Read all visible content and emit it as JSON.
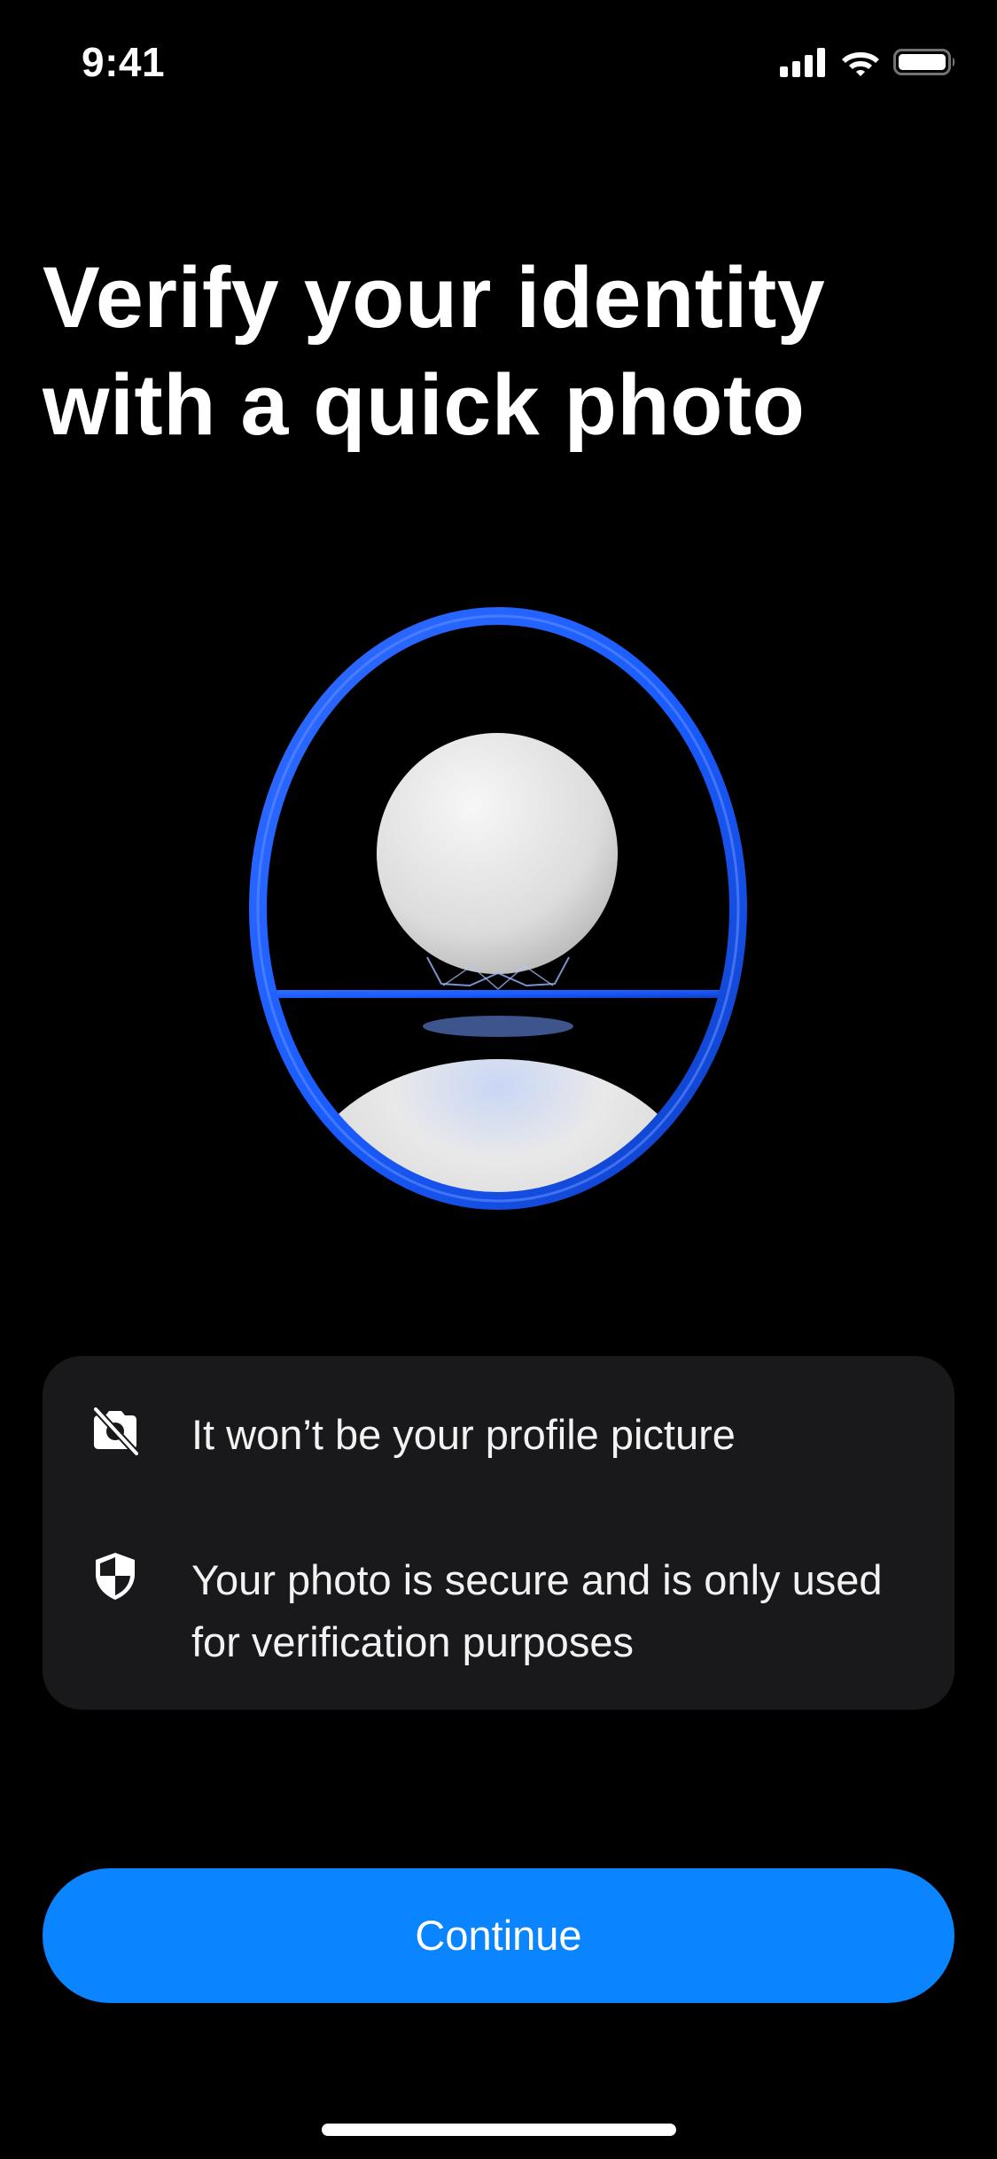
{
  "status_bar": {
    "time": "9:41",
    "icons": [
      "cellular-signal-icon",
      "wifi-icon",
      "battery-icon"
    ]
  },
  "headline": "Verify your identity with a quick photo",
  "illustration": {
    "icon": "face-frame-icon",
    "colors": {
      "ring": "#1a5cff",
      "figure": "#e6e6e6"
    }
  },
  "info_items": [
    {
      "icon": "no-camera-icon",
      "text": "It won’t be your profile picture"
    },
    {
      "icon": "shield-icon",
      "text": "Your photo is secure and is only used for verification purposes"
    }
  ],
  "primary_action": {
    "label": "Continue",
    "color": "#0a84ff"
  }
}
